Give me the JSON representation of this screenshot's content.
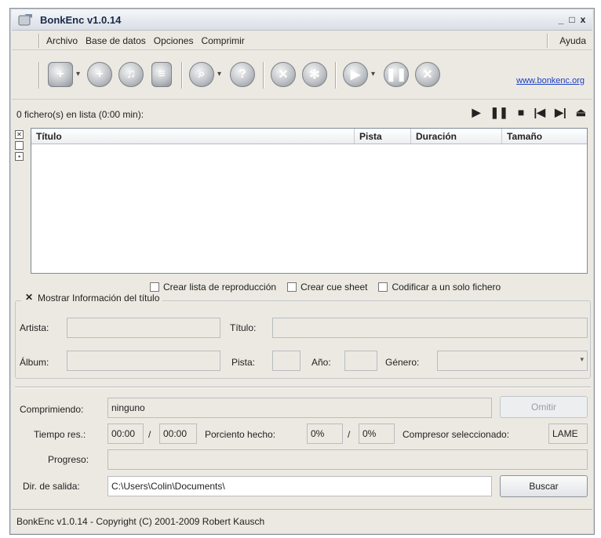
{
  "window": {
    "title": "BonkEnc v1.0.14",
    "controls": [
      "_",
      "□",
      "x"
    ]
  },
  "menu": {
    "items": [
      "Archivo",
      "Base de datos",
      "Opciones",
      "Comprimir"
    ],
    "help": "Ayuda"
  },
  "toolbar": {
    "icons": [
      "add-file-icon",
      "add-folder-icon",
      "add-cd-icon",
      "playlist-icon",
      "query-icon",
      "cddb-icon",
      "settings-icon",
      "config-icon",
      "start-encode-icon",
      "pause-icon",
      "stop-icon"
    ],
    "link": "www.bonkenc.org"
  },
  "list": {
    "status": "0 fichero(s) en lista (0:00 min):",
    "columns": [
      "Título",
      "Pista",
      "Duración",
      "Tamaño"
    ],
    "player": [
      "▶",
      "❚❚",
      "■",
      "|◀",
      "▶|",
      "⏏"
    ]
  },
  "options": {
    "playlist": "Crear lista de reproducción",
    "cuesheet": "Crear cue sheet",
    "single_file": "Codificar a un solo fichero"
  },
  "title_info": {
    "legend": "Mostrar Información del título",
    "artist_label": "Artista:",
    "title_label": "Título:",
    "album_label": "Álbum:",
    "track_label": "Pista:",
    "year_label": "Año:",
    "genre_label": "Género:"
  },
  "progress": {
    "compressing_label": "Comprimiendo:",
    "compressing_value": "ninguno",
    "skip_button": "Omitir",
    "time_label": "Tiempo res.:",
    "time_value": "00:00",
    "time_sep": "/",
    "time_total": "00:00",
    "percent_label": "Porciento hecho:",
    "percent_value": "0%",
    "percent_sep": "/",
    "percent_total": "0%",
    "encoder_label": "Compresor seleccionado:",
    "encoder_value": "LAME",
    "progress_label": "Progreso:",
    "progress_fraction": 0,
    "output_label": "Dir. de salida:",
    "output_value": "C:\\Users\\Colin\\Documents\\",
    "browse_button": "Buscar"
  },
  "statusbar": {
    "text": "BonkEnc v1.0.14 - Copyright (C) 2001-2009 Robert Kausch"
  }
}
